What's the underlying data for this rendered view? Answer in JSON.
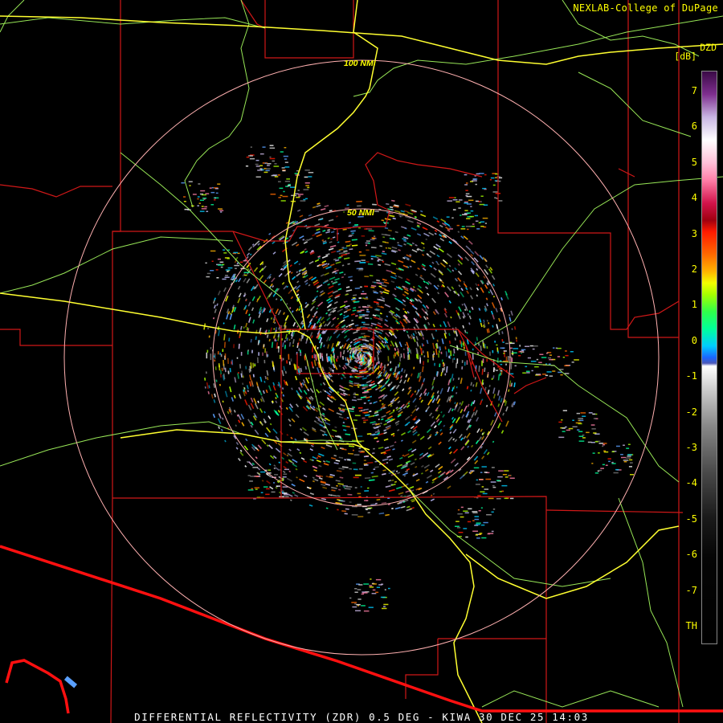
{
  "credit": "NEXLAB-College of DuPage",
  "caption": "DIFFERENTIAL REFLECTIVITY (ZDR) 0.5 DEG - KIWA 30 DEC 25 14:03",
  "range_rings": [
    {
      "label": "100 NMI",
      "radius_nmi": 100
    },
    {
      "label": "50 NMI",
      "radius_nmi": 50
    }
  ],
  "scale": {
    "product": "DZD",
    "unit": "[dB]",
    "ticks": [
      "7",
      "6",
      "5",
      "4",
      "3",
      "2",
      "1",
      "0",
      "-1",
      "-2",
      "-3",
      "-4",
      "-5",
      "-6",
      "-7",
      "TH"
    ]
  },
  "colors": {
    "county_lines": "#d01818",
    "state_border": "#ff1010",
    "highways": "#ffff30",
    "roads": "#a8ff60",
    "rings": "#ffb0b0",
    "labels": "#ffff00"
  }
}
